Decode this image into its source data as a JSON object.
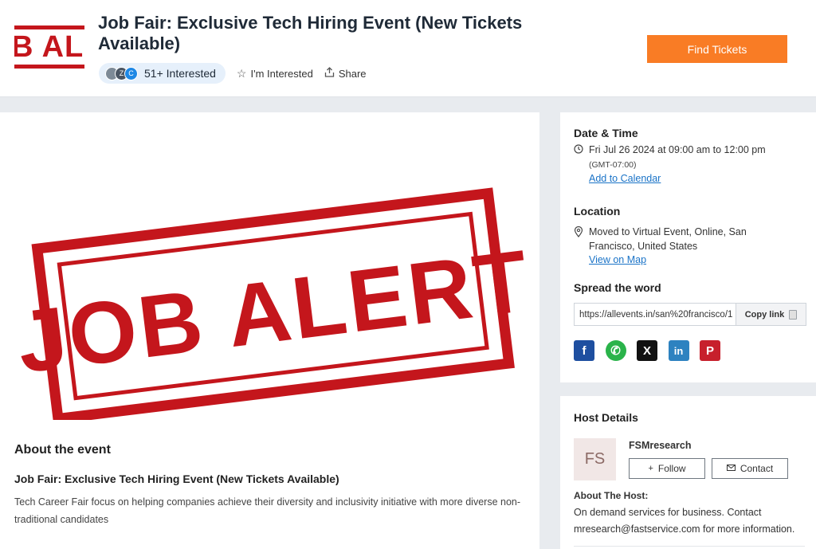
{
  "header": {
    "logo_text": "B ALER'",
    "title": "Job Fair: Exclusive Tech Hiring Event (New Tickets Available)",
    "avatar_initials": [
      "",
      "Z",
      "C"
    ],
    "interested_count": "51+ Interested",
    "im_interested_label": "I'm Interested",
    "share_label": "Share",
    "find_tickets_label": "Find Tickets",
    "accent_color": "#f97c25"
  },
  "hero": {
    "stamp_text": "JOB ALERT",
    "stamp_color": "#c4161c"
  },
  "about": {
    "heading": "About the event",
    "title": "Job Fair: Exclusive Tech Hiring Event (New Tickets Available)",
    "description": "Tech Career Fair focus on helping companies achieve their diversity and inclusivity initiative with more diverse non-traditional candidates"
  },
  "date_time": {
    "heading": "Date & Time",
    "icon": "clock-icon",
    "value": "Fri Jul 26 2024 at 09:00 am to 12:00 pm",
    "timezone": "(GMT-07:00)",
    "add_calendar_label": "Add to Calendar"
  },
  "location": {
    "heading": "Location",
    "icon": "map-pin-icon",
    "value": "Moved to Virtual Event, Online, San Francisco, United States",
    "view_map_label": "View on Map"
  },
  "spread": {
    "heading": "Spread the word",
    "url": "https://allevents.in/san%20francisco/1",
    "copy_label": "Copy link",
    "socials": [
      {
        "name": "facebook",
        "glyph": "f"
      },
      {
        "name": "whatsapp",
        "glyph": "✆"
      },
      {
        "name": "x",
        "glyph": "X"
      },
      {
        "name": "linkedin",
        "glyph": "in"
      },
      {
        "name": "pinterest",
        "glyph": "P"
      }
    ]
  },
  "host": {
    "heading": "Host Details",
    "initials": "FS",
    "name": "FSMresearch",
    "follow_label": "Follow",
    "contact_label": "Contact",
    "about_heading": "About The Host:",
    "about_text": "On demand services for business. Contact mresearch@fastservice.com for more information."
  }
}
